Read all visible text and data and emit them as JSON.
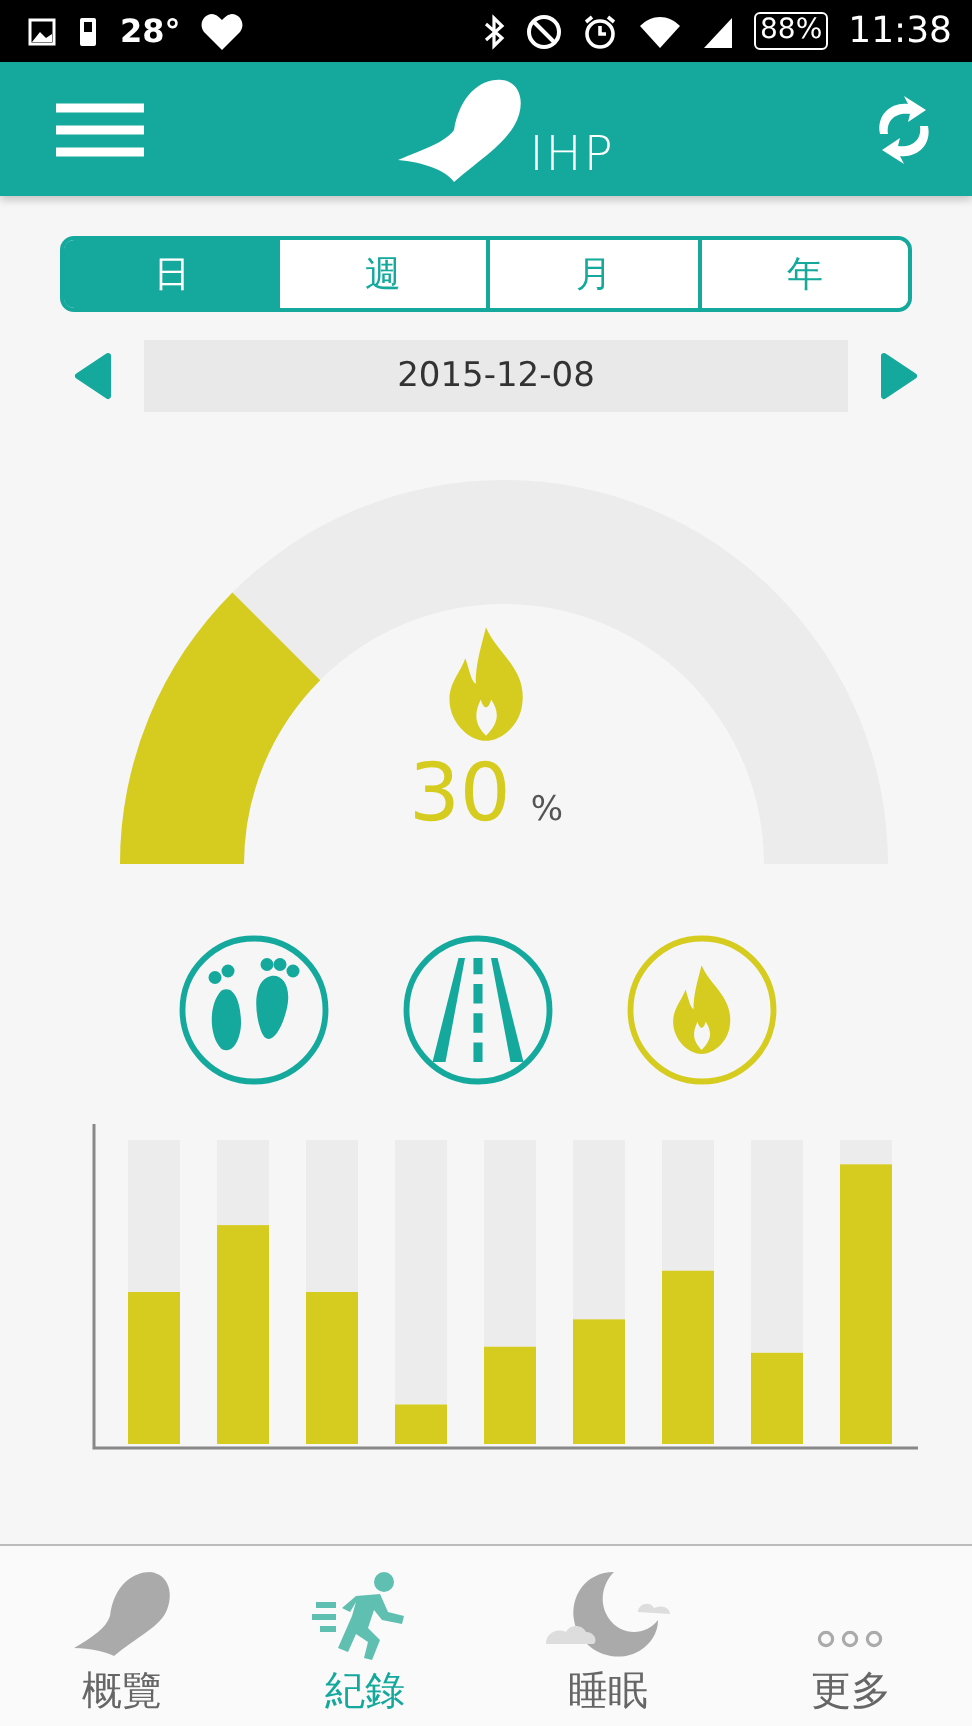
{
  "status_bar": {
    "temperature": "28°",
    "battery": "88%",
    "time": "11:38"
  },
  "header": {
    "logo_text": "IHP"
  },
  "period_tabs": [
    {
      "label": "日",
      "selected": true
    },
    {
      "label": "週",
      "selected": false
    },
    {
      "label": "月",
      "selected": false
    },
    {
      "label": "年",
      "selected": false
    }
  ],
  "date_nav": {
    "date": "2015-12-08"
  },
  "gauge": {
    "value": "30",
    "unit": "%"
  },
  "metrics": [
    {
      "kind": "steps",
      "selected": false
    },
    {
      "kind": "distance",
      "selected": false
    },
    {
      "kind": "calories",
      "selected": true
    }
  ],
  "bottom_nav": [
    {
      "kind": "overview",
      "label": "概覽",
      "selected": false
    },
    {
      "kind": "records",
      "label": "紀錄",
      "selected": true
    },
    {
      "kind": "sleep",
      "label": "睡眠",
      "selected": false
    },
    {
      "kind": "more",
      "label": "更多",
      "selected": false
    }
  ]
}
